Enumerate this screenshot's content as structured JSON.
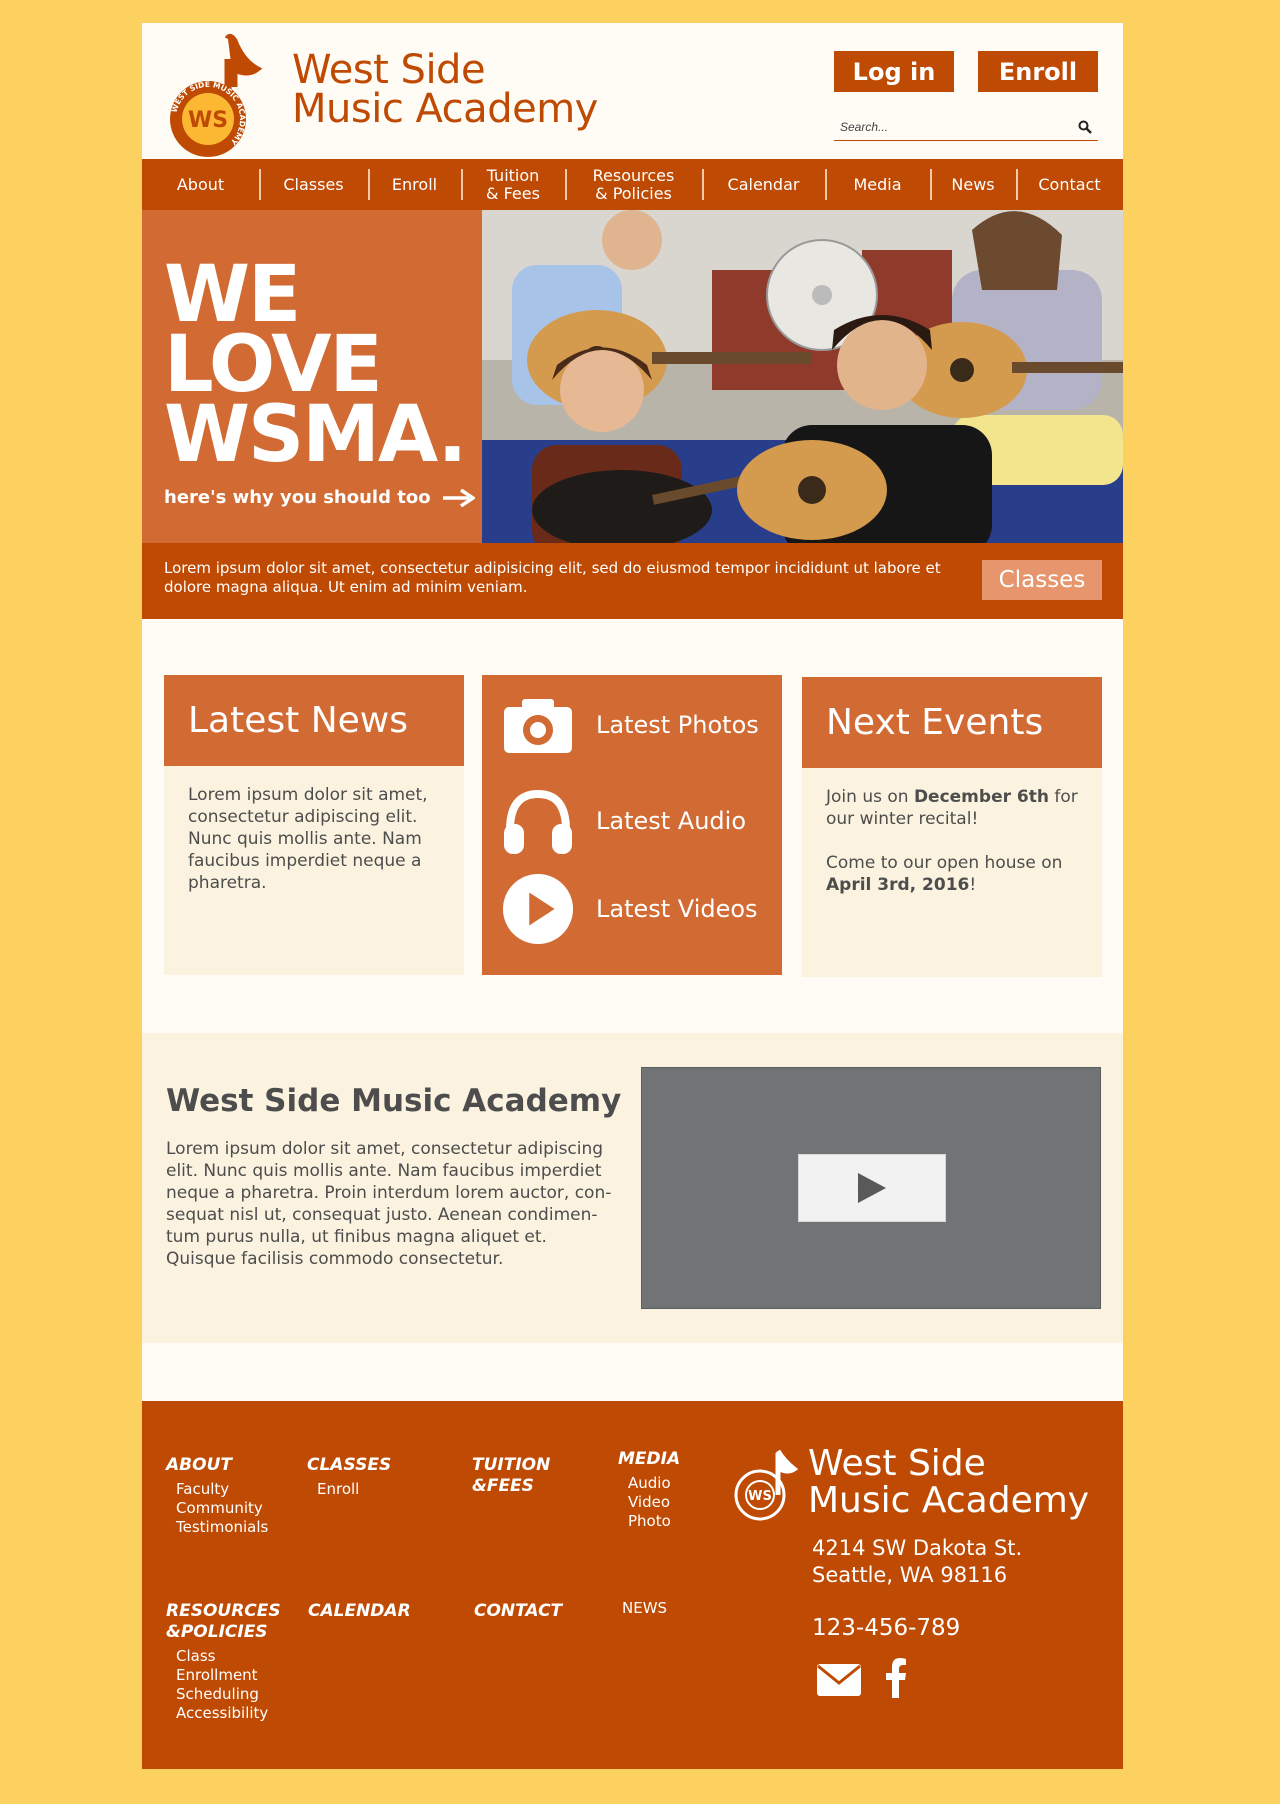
{
  "brand": {
    "name_line1": "West Side",
    "name_line2": "Music Academy",
    "logo_text": "WS",
    "logo_ring_text": "WEST SIDE MUSIC ACADEMY",
    "color_primary": "#BF4A03",
    "color_secondary": "#D26A33",
    "color_background": "#FDD160"
  },
  "header": {
    "login_label": "Log in",
    "enroll_label": "Enroll",
    "search_placeholder": "Search..."
  },
  "nav": {
    "items": [
      {
        "line1": "About",
        "line2": ""
      },
      {
        "line1": "Classes",
        "line2": ""
      },
      {
        "line1": "Enroll",
        "line2": ""
      },
      {
        "line1": "Tuition",
        "line2": "& Fees"
      },
      {
        "line1": "Resources",
        "line2": "& Policies"
      },
      {
        "line1": "Calendar",
        "line2": ""
      },
      {
        "line1": "Media",
        "line2": ""
      },
      {
        "line1": "News",
        "line2": ""
      },
      {
        "line1": "Contact",
        "line2": ""
      }
    ]
  },
  "hero": {
    "title_line1": "WE",
    "title_line2": "LOVE",
    "title_line3": "WSMA.",
    "link_text": "here's why you should too",
    "bar_text": "Lorem ipsum dolor sit amet, consectetur adipisicing elit, sed do eiusmod tempor incididunt ut labore et dolore magna aliqua. Ut enim ad minim veniam.",
    "classes_button": "Classes"
  },
  "news": {
    "title": "Latest News",
    "body": "Lorem ipsum dolor sit amet, consectetur adipiscing elit. Nunc quis mollis ante. Nam faucibus imperdiet neque a pharetra."
  },
  "media": {
    "photos_label": "Latest Photos",
    "audio_label": "Latest Audio",
    "videos_label": "Latest Videos"
  },
  "events": {
    "title": "Next Events",
    "event1_pre": "Join us on ",
    "event1_date": "December 6th",
    "event1_post": " for our winter recital!",
    "event2_pre": "Come to our open house on ",
    "event2_date": "April 3rd, 2016",
    "event2_post": "!"
  },
  "about": {
    "title": "West Side Music Academy",
    "body": "Lorem ipsum dolor sit amet, consectetur adipiscing elit. Nunc quis mollis ante. Nam faucibus imperdiet neque a pharetra. Proin interdum lorem auctor, con-sequat nisl ut, consequat justo. Aenean condimen-tum purus nulla, ut finibus magna aliquet et. Quisque facilisis commodo consectetur."
  },
  "footer": {
    "about": {
      "head": "ABOUT",
      "links": [
        "Faculty",
        "Community",
        "Testimonials"
      ]
    },
    "classes": {
      "head": "CLASSES",
      "links": [
        "Enroll"
      ]
    },
    "tuition": {
      "head_line1": "TUITION",
      "head_line2": "&FEES"
    },
    "media": {
      "head": "MEDIA",
      "links": [
        "Audio",
        "Video",
        "Photo"
      ]
    },
    "resources": {
      "head_line1": "RESOURCES",
      "head_line2": "&POLICIES",
      "links": [
        "Class",
        "Enrollment",
        "Scheduling",
        "Accessibility"
      ]
    },
    "calendar": {
      "head": "CALENDAR"
    },
    "contact": {
      "head": "CONTACT"
    },
    "news": {
      "head": "NEWS"
    },
    "address_line1": "4214 SW Dakota St.",
    "address_line2": "Seattle, WA 98116",
    "phone": "123-456-789"
  }
}
